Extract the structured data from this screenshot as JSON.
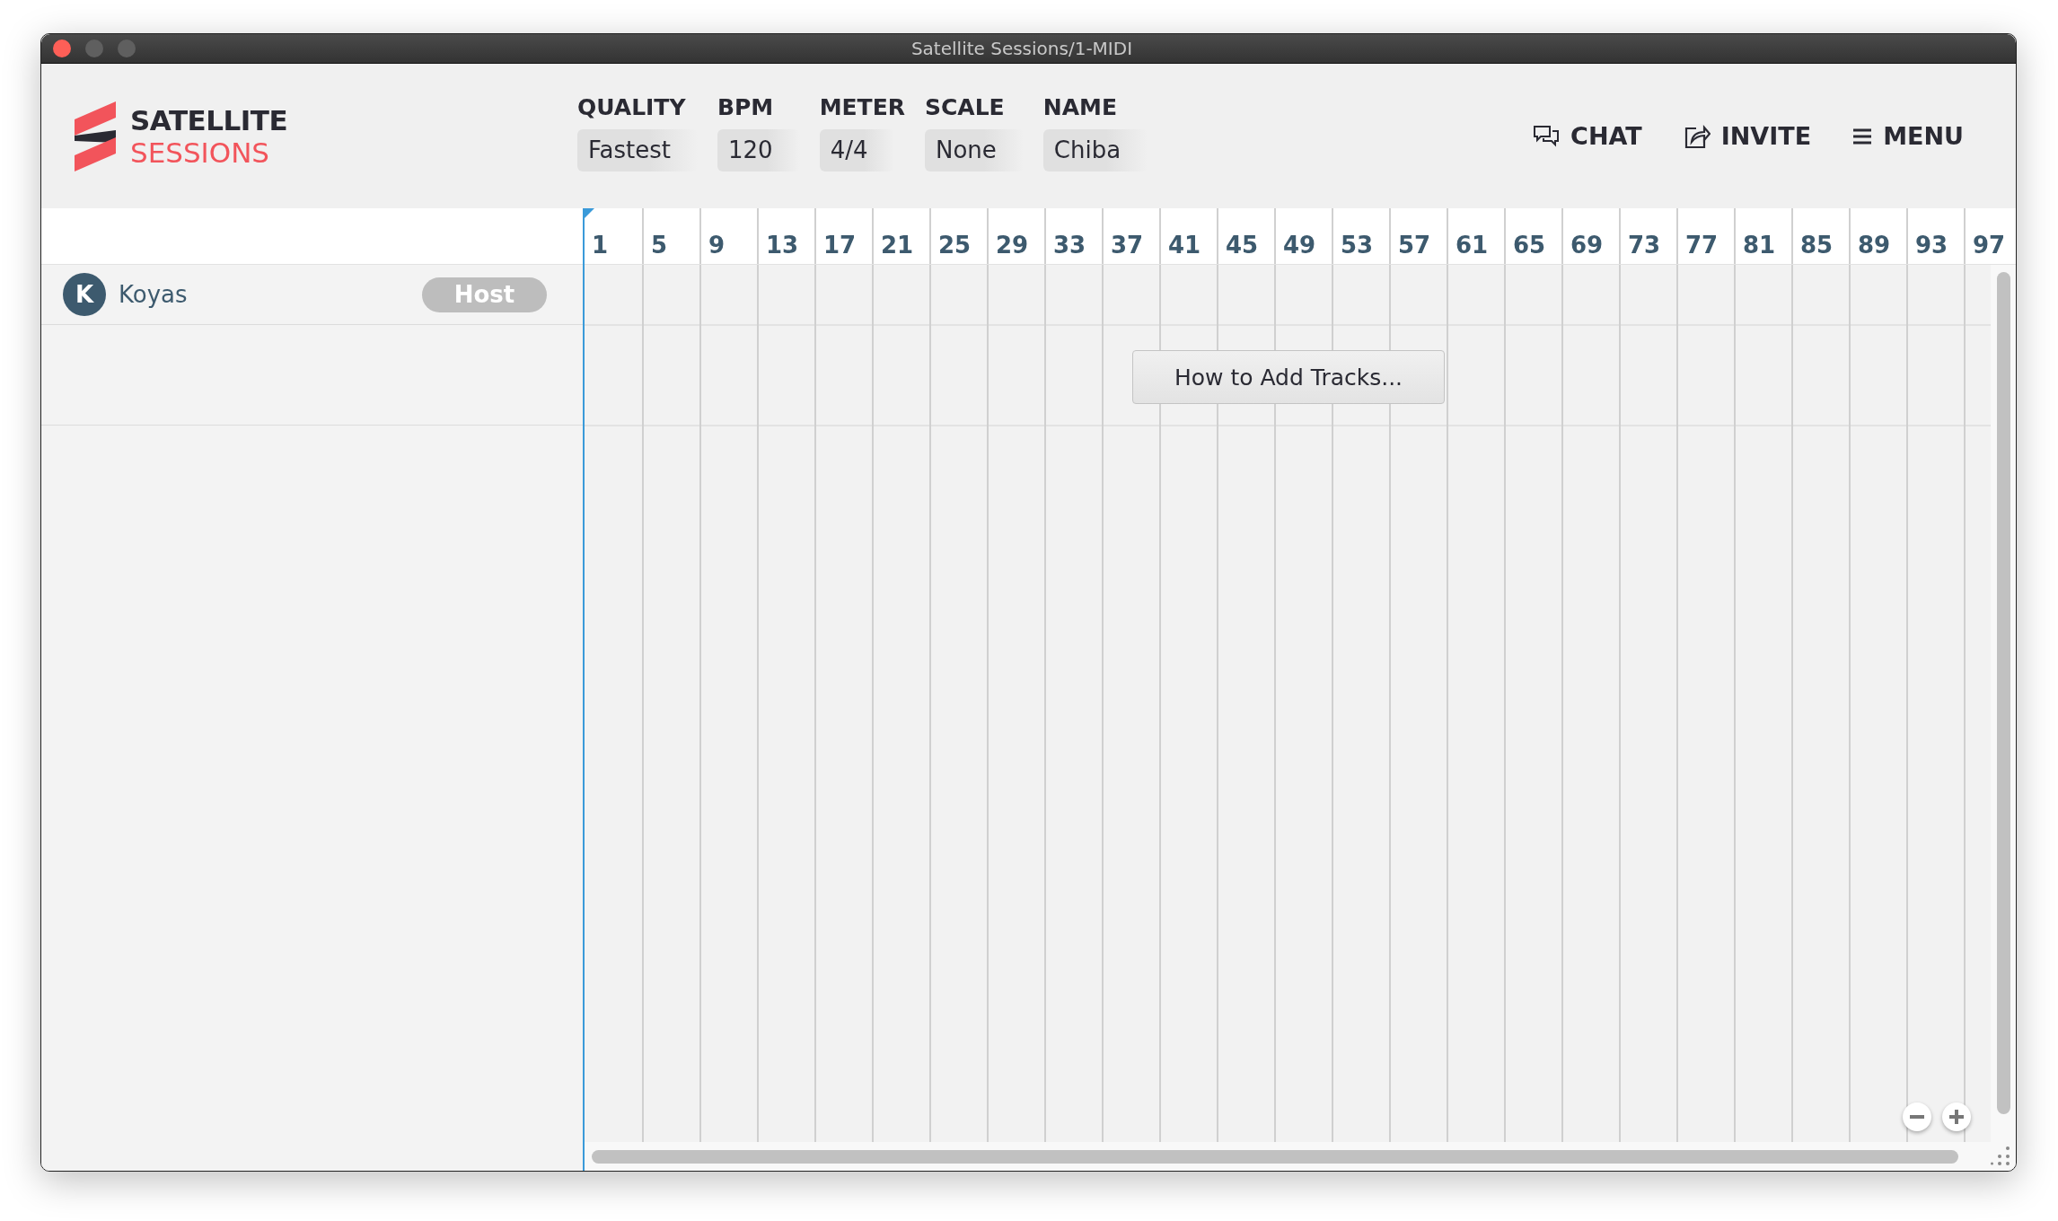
{
  "window": {
    "title": "Satellite Sessions/1-MIDI"
  },
  "logo": {
    "line_1": "SATELLITE",
    "line_2": "SESSIONS"
  },
  "settings": [
    {
      "label": "QUALITY",
      "value": "Fastest"
    },
    {
      "label": "BPM",
      "value": "120"
    },
    {
      "label": "METER",
      "value": "4/4"
    },
    {
      "label": "SCALE",
      "value": "None"
    },
    {
      "label": "NAME",
      "value": "Chiba"
    }
  ],
  "actions": [
    {
      "kind": "chat",
      "label": "CHAT"
    },
    {
      "kind": "invite",
      "label": "INVITE"
    },
    {
      "kind": "menu",
      "label": "MENU"
    }
  ],
  "tracks": [
    {
      "initial": "K",
      "name": "Koyas",
      "role": "Host"
    }
  ],
  "timeline": {
    "bars": [
      "1",
      "5",
      "9",
      "13",
      "17",
      "21",
      "25",
      "29",
      "33",
      "37",
      "41",
      "45",
      "49",
      "53",
      "57",
      "61",
      "65",
      "69",
      "73",
      "77",
      "81",
      "85",
      "89",
      "93",
      "97"
    ],
    "hint_button": "How to Add Tracks..."
  }
}
